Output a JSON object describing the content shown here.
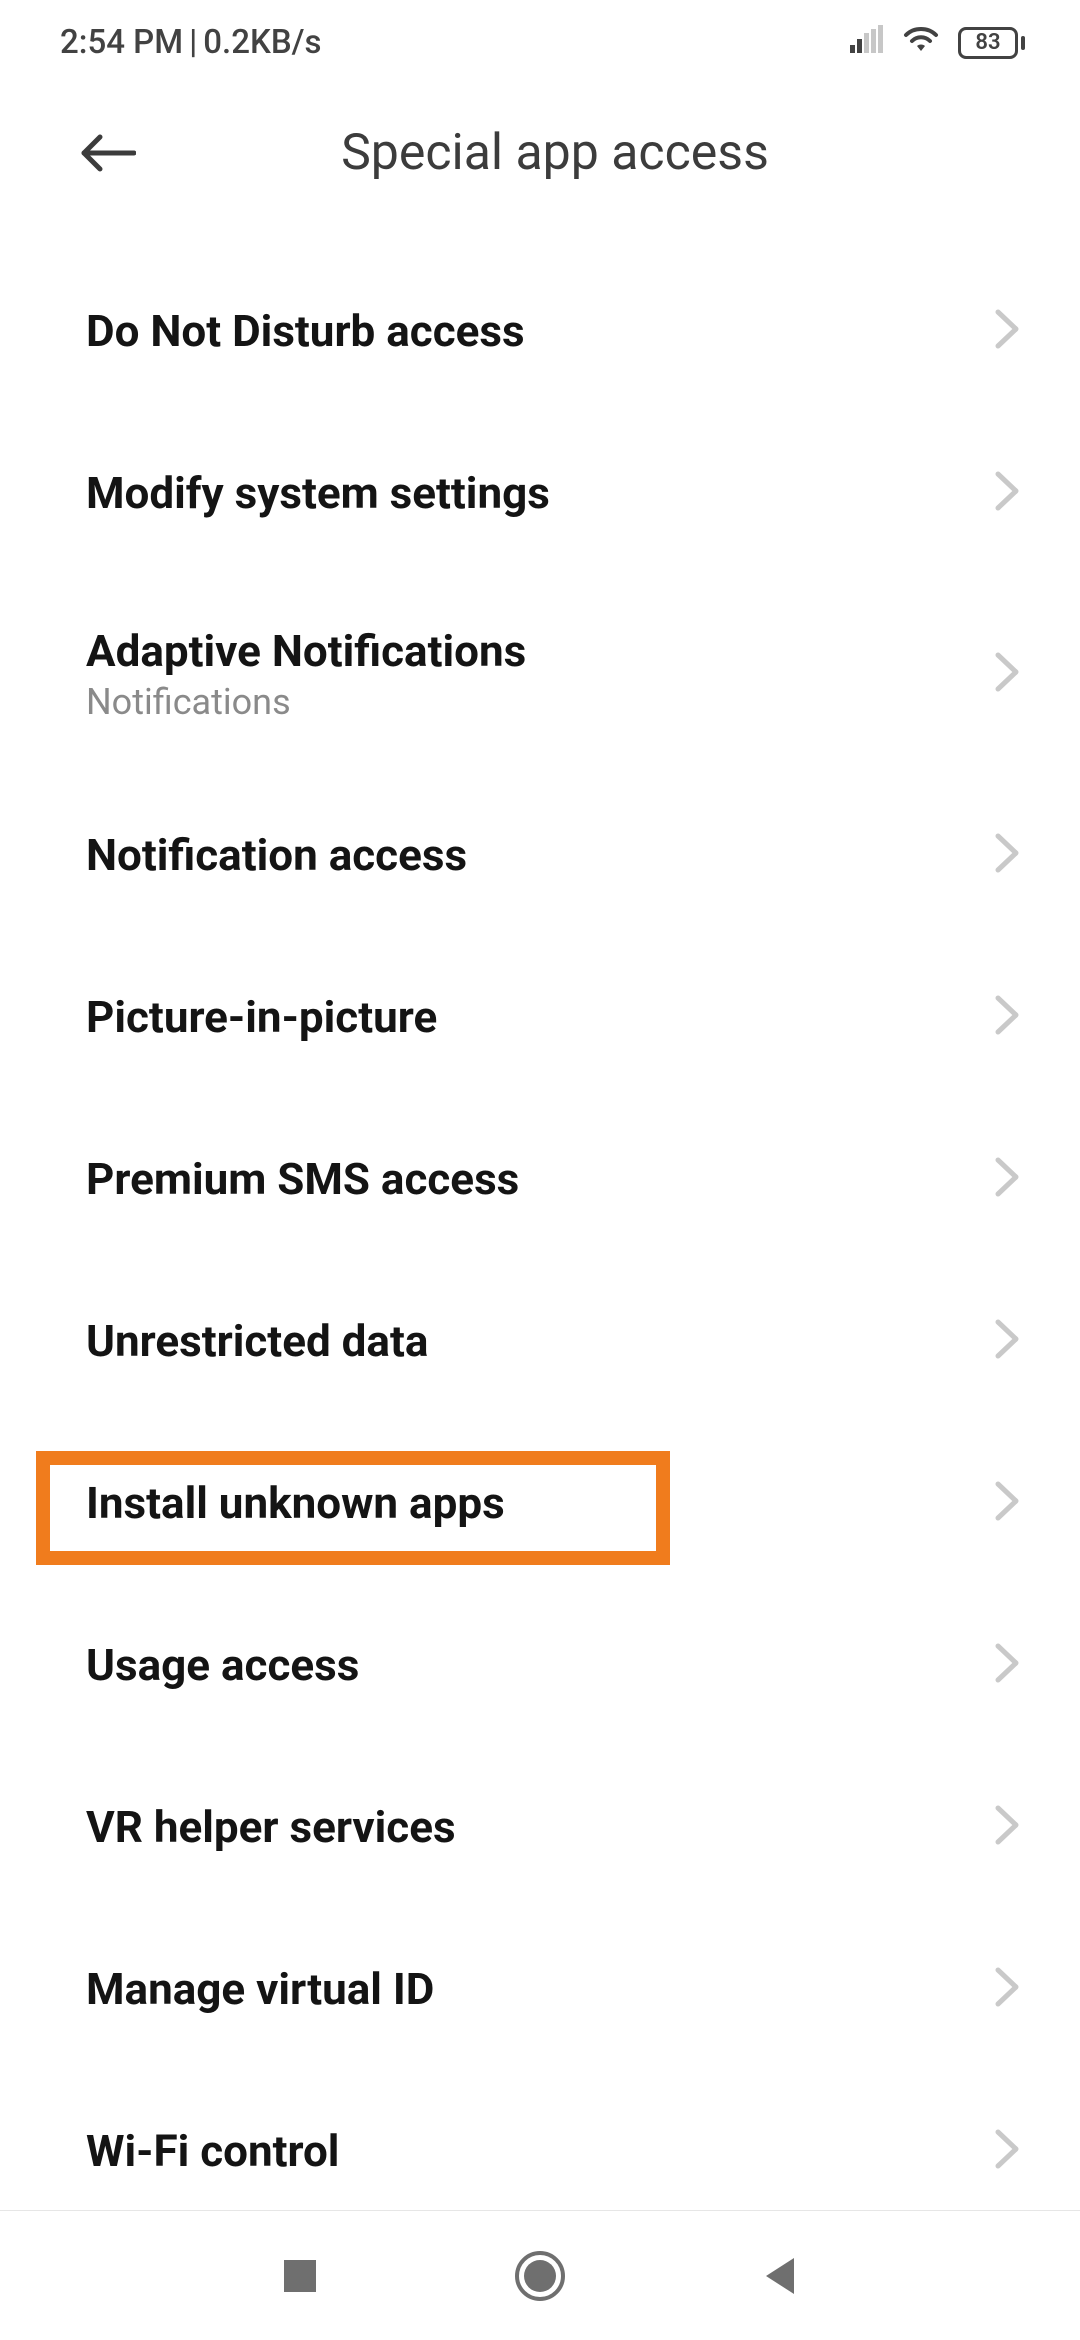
{
  "status": {
    "time": "2:54 PM",
    "separator": "|",
    "net_speed": "0.2KB/s",
    "battery_pct": "83"
  },
  "header": {
    "title": "Special app access"
  },
  "rows": [
    {
      "title": "Do Not Disturb access",
      "subtitle": ""
    },
    {
      "title": "Modify system settings",
      "subtitle": ""
    },
    {
      "title": "Adaptive Notifications",
      "subtitle": "Notifications"
    },
    {
      "title": "Notification access",
      "subtitle": ""
    },
    {
      "title": "Picture-in-picture",
      "subtitle": ""
    },
    {
      "title": "Premium SMS access",
      "subtitle": ""
    },
    {
      "title": "Unrestricted data",
      "subtitle": ""
    },
    {
      "title": "Install unknown apps",
      "subtitle": ""
    },
    {
      "title": "Usage access",
      "subtitle": ""
    },
    {
      "title": "VR helper services",
      "subtitle": ""
    },
    {
      "title": "Manage virtual ID",
      "subtitle": ""
    },
    {
      "title": "Wi-Fi control",
      "subtitle": ""
    }
  ],
  "highlight": {
    "row_index": 7,
    "color": "#f07c1d"
  }
}
